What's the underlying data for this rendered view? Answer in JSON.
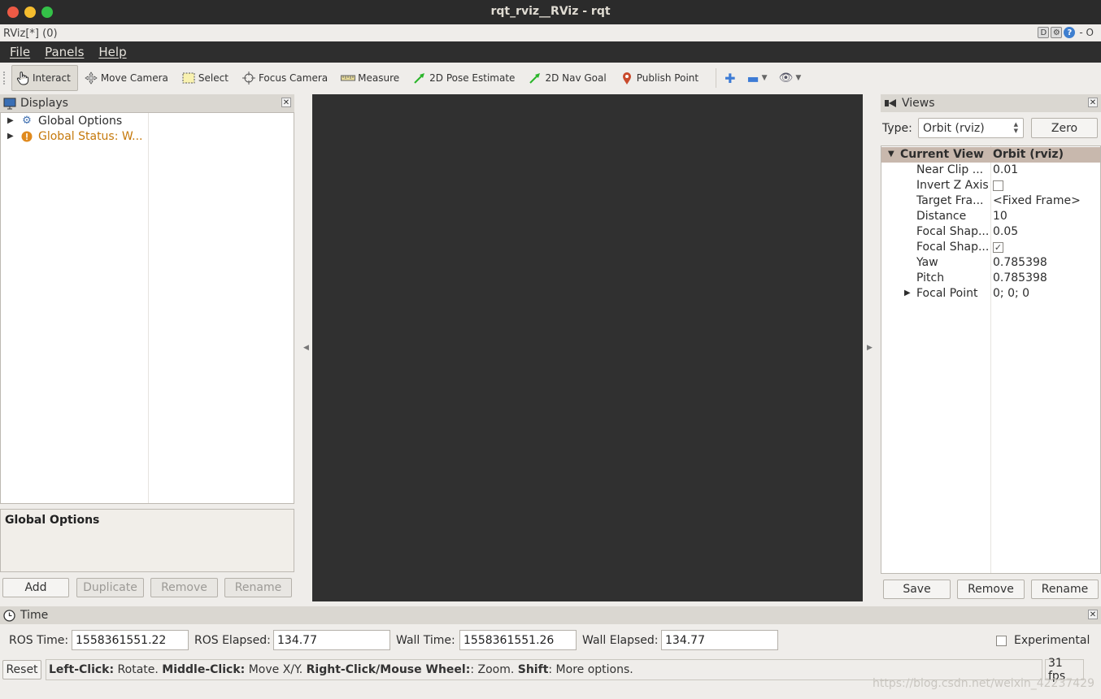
{
  "window": {
    "title": "rqt_rviz__RViz - rqt"
  },
  "plugin": {
    "title": "RViz[*] (0)",
    "tools": [
      "D",
      "?",
      "- O"
    ]
  },
  "menu": {
    "items": [
      "File",
      "Panels",
      "Help"
    ]
  },
  "toolbar": {
    "tools": [
      {
        "label": "Interact",
        "icon": "hand-icon"
      },
      {
        "label": "Move Camera",
        "icon": "move-camera-icon"
      },
      {
        "label": "Select",
        "icon": "select-icon"
      },
      {
        "label": "Focus Camera",
        "icon": "focus-camera-icon"
      },
      {
        "label": "Measure",
        "icon": "ruler-icon"
      },
      {
        "label": "2D Pose Estimate",
        "icon": "pose-arrow-icon"
      },
      {
        "label": "2D Nav Goal",
        "icon": "nav-goal-arrow-icon"
      },
      {
        "label": "Publish Point",
        "icon": "map-pin-icon"
      }
    ]
  },
  "displays": {
    "title": "Displays",
    "items": [
      {
        "label": "Global Options",
        "icon": "gear-icon"
      },
      {
        "label": "Global Status: W...",
        "icon": "warning-icon"
      }
    ],
    "description": "Global Options",
    "buttons": {
      "add": "Add",
      "duplicate": "Duplicate",
      "remove": "Remove",
      "rename": "Rename"
    }
  },
  "views": {
    "title": "Views",
    "type_label": "Type:",
    "type_value": "Orbit (rviz)",
    "zero": "Zero",
    "header": {
      "key": "Current View",
      "value": "Orbit (rviz)"
    },
    "rows": [
      {
        "key": "Near Clip ...",
        "value": "0.01"
      },
      {
        "key": "Invert Z Axis",
        "value": ""
      },
      {
        "key": "Target Fra...",
        "value": "<Fixed Frame>"
      },
      {
        "key": "Distance",
        "value": "10"
      },
      {
        "key": "Focal Shap...",
        "value": "0.05"
      },
      {
        "key": "Focal Shap...",
        "value": ""
      },
      {
        "key": "Yaw",
        "value": "0.785398"
      },
      {
        "key": "Pitch",
        "value": "0.785398"
      },
      {
        "key": "Focal Point",
        "value": "0; 0; 0"
      }
    ],
    "buttons": {
      "save": "Save",
      "remove": "Remove",
      "rename": "Rename"
    }
  },
  "time": {
    "title": "Time",
    "ros_time_label": "ROS Time:",
    "ros_time": "1558361551.22",
    "ros_elapsed_label": "ROS Elapsed:",
    "ros_elapsed": "134.77",
    "wall_time_label": "Wall Time:",
    "wall_time": "1558361551.26",
    "wall_elapsed_label": "Wall Elapsed:",
    "wall_elapsed": "134.77",
    "experimental": "Experimental"
  },
  "status": {
    "reset": "Reset",
    "hint_parts": [
      {
        "b": "Left-Click:",
        "t": " Rotate. "
      },
      {
        "b": "Middle-Click:",
        "t": " Move X/Y. "
      },
      {
        "b": "Right-Click/Mouse Wheel:",
        "t": ": Zoom. "
      },
      {
        "b": "Shift",
        "t": ": More options."
      }
    ],
    "fps": "31 fps"
  },
  "watermark": "https://blog.csdn.net/weixin_42237429"
}
